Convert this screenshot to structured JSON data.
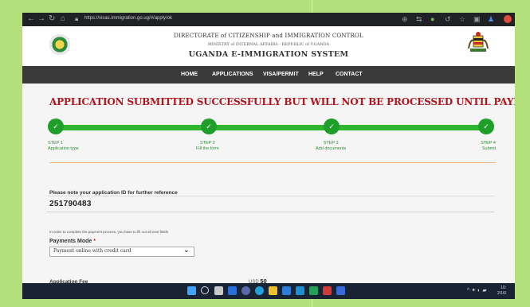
{
  "browser": {
    "address": "https://visas.immigration.go.ug/#/apply/ok"
  },
  "header": {
    "line1": "DIRECTORATE of CITIZENSHIP and IMMIGRATION CONTROL",
    "line2": "MINISTRY of INTERNAL AFFAIRS - REPUBLIC of UGANDA",
    "line3": "UGANDA E-IMMIGRATION SYSTEM"
  },
  "nav": {
    "items": [
      "HOME",
      "APPLICATIONS",
      "VISA/PERMIT",
      "HELP",
      "CONTACT"
    ]
  },
  "page": {
    "title": "APPLICATION SUBMITTED SUCCESSFULLY BUT WILL NOT BE PROCESSED UNTIL PAYMENT IS DONE",
    "steps": [
      {
        "step": "STEP 1",
        "label": "Application type"
      },
      {
        "step": "STEP 2",
        "label": "Fill the form"
      },
      {
        "step": "STEP 3",
        "label": "Add documents"
      },
      {
        "step": "STEP 4",
        "label": "Submit"
      }
    ],
    "check_glyph": "✓",
    "note": "Please note your application ID for further reference",
    "application_id": "251790483",
    "payment_note": "In order to complete the payment process, you have to fill out all next fields",
    "payment_mode_label": "Payments Mode",
    "required_mark": "*",
    "payment_mode_value": "Payment online with credit card",
    "fee_label": "Application Fee",
    "fee_currency": "USD",
    "fee_value": "50"
  },
  "taskbar": {
    "time": "10:",
    "date": "2/16/"
  },
  "colors": {
    "title_red": "#b0161e",
    "progress_green": "#2fb52f",
    "step_green": "#1f9e2a",
    "nav_dark": "#3a3a3a",
    "frame_green": "#b4e07c"
  }
}
